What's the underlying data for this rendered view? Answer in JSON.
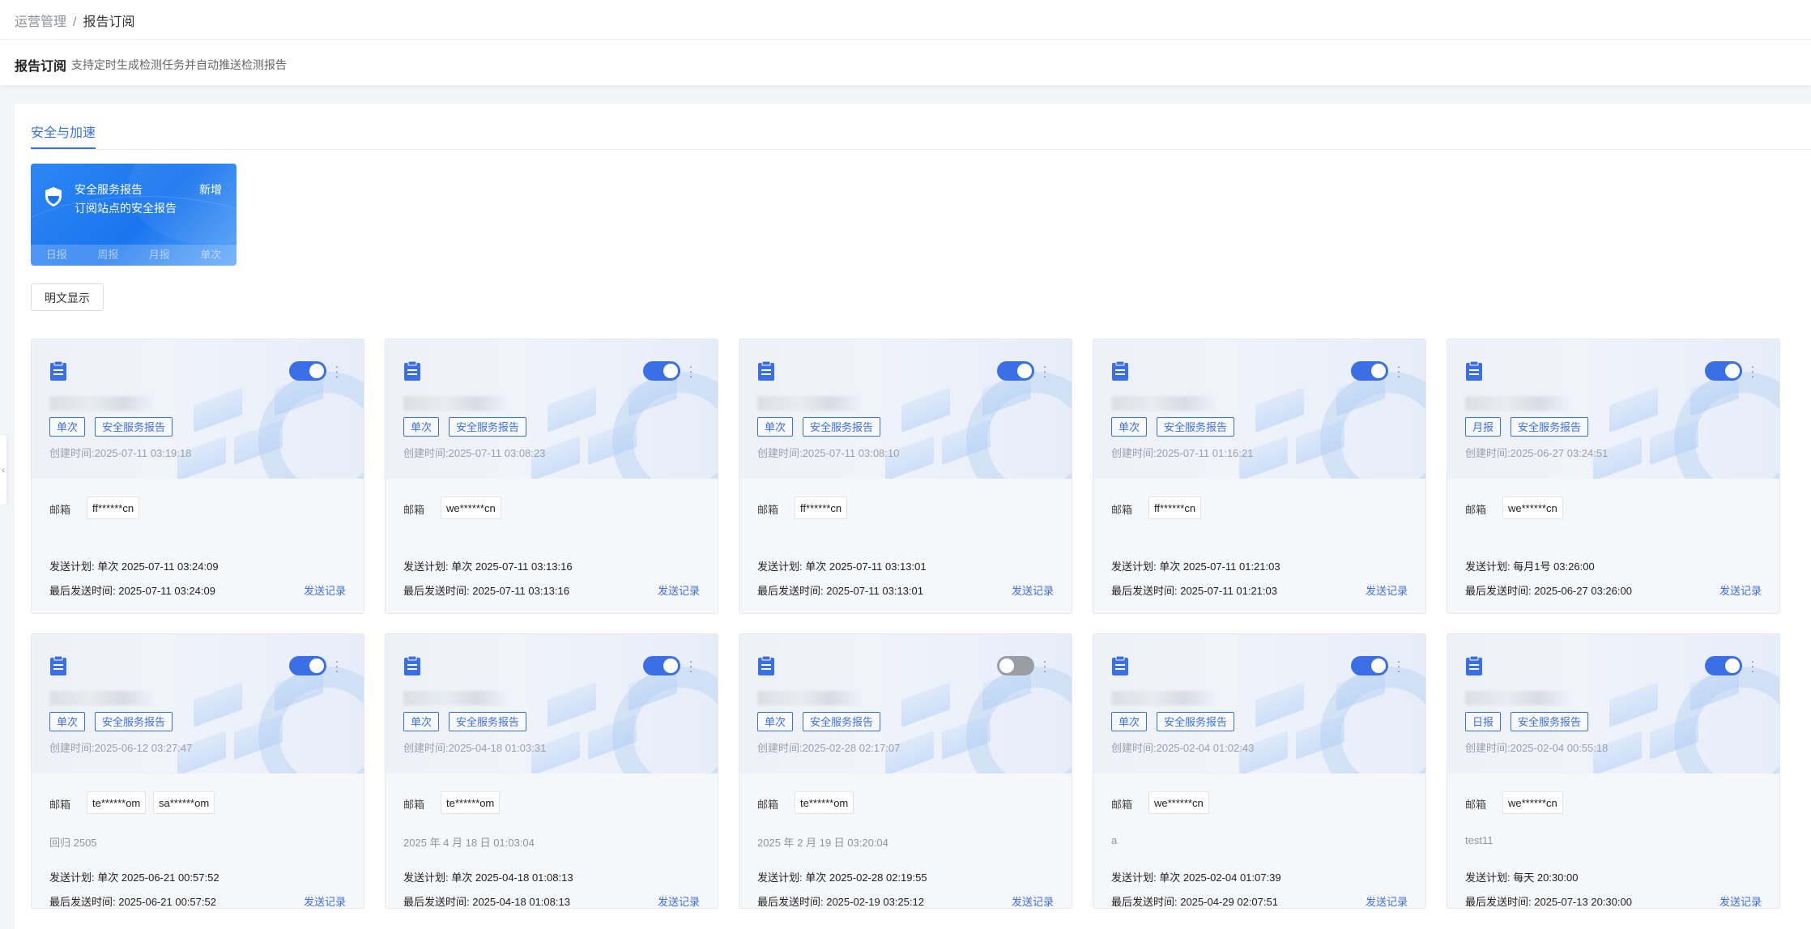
{
  "breadcrumb": {
    "parent": "运营管理",
    "separator": "/",
    "current": "报告订阅"
  },
  "header": {
    "title": "报告订阅",
    "description": "支持定时生成检测任务并自动推送检测报告"
  },
  "tabs": [
    {
      "label": "安全与加速",
      "active": true
    }
  ],
  "promo": {
    "title": "安全服务报告",
    "subtitle": "订阅站点的安全报告",
    "add_label": "新增",
    "frequencies": [
      "日报",
      "周报",
      "月报",
      "单次"
    ]
  },
  "plain_toggle_label": "明文显示",
  "labels": {
    "email": "邮箱",
    "history": "发送记录"
  },
  "colors": {
    "accent": "#3b6fe8",
    "toggle_on": "#3b6fe8",
    "toggle_off": "#9a9da3"
  },
  "cards": [
    {
      "enabled": true,
      "freq": "单次",
      "type": "安全服务报告",
      "created": "创建时间:2025-07-11 03:19:18",
      "emails": [
        "ff******cn"
      ],
      "note": "",
      "plan": "发送计划: 单次 2025-07-11 03:24:09",
      "last": "最后发送时间: 2025-07-11 03:24:09"
    },
    {
      "enabled": true,
      "freq": "单次",
      "type": "安全服务报告",
      "created": "创建时间:2025-07-11 03:08:23",
      "emails": [
        "we******cn"
      ],
      "note": "",
      "plan": "发送计划: 单次 2025-07-11 03:13:16",
      "last": "最后发送时间: 2025-07-11 03:13:16"
    },
    {
      "enabled": true,
      "freq": "单次",
      "type": "安全服务报告",
      "created": "创建时间:2025-07-11 03:08:10",
      "emails": [
        "ff******cn"
      ],
      "note": "",
      "plan": "发送计划: 单次 2025-07-11 03:13:01",
      "last": "最后发送时间: 2025-07-11 03:13:01"
    },
    {
      "enabled": true,
      "freq": "单次",
      "type": "安全服务报告",
      "created": "创建时间:2025-07-11 01:16:21",
      "emails": [
        "ff******cn"
      ],
      "note": "",
      "plan": "发送计划: 单次 2025-07-11 01:21:03",
      "last": "最后发送时间: 2025-07-11 01:21:03"
    },
    {
      "enabled": true,
      "freq": "月报",
      "type": "安全服务报告",
      "created": "创建时间:2025-06-27 03:24:51",
      "emails": [
        "we******cn"
      ],
      "note": "",
      "plan": "发送计划: 每月1号 03:26:00",
      "last": "最后发送时间: 2025-06-27 03:26:00"
    },
    {
      "enabled": true,
      "freq": "单次",
      "type": "安全服务报告",
      "created": "创建时间:2025-06-12 03:27:47",
      "emails": [
        "te******om",
        "sa******om"
      ],
      "note": "回归 2505",
      "plan": "发送计划: 单次 2025-06-21 00:57:52",
      "last": "最后发送时间: 2025-06-21 00:57:52"
    },
    {
      "enabled": true,
      "freq": "单次",
      "type": "安全服务报告",
      "created": "创建时间:2025-04-18 01:03:31",
      "emails": [
        "te******om"
      ],
      "note": "2025 年 4 月 18 日 01:03:04",
      "plan": "发送计划: 单次 2025-04-18 01:08:13",
      "last": "最后发送时间: 2025-04-18 01:08:13"
    },
    {
      "enabled": false,
      "freq": "单次",
      "type": "安全服务报告",
      "created": "创建时间:2025-02-28 02:17:07",
      "emails": [
        "te******om"
      ],
      "note": "2025 年 2 月 19 日 03:20:04",
      "plan": "发送计划: 单次 2025-02-28 02:19:55",
      "last": "最后发送时间: 2025-02-19 03:25:12"
    },
    {
      "enabled": true,
      "freq": "单次",
      "type": "安全服务报告",
      "created": "创建时间:2025-02-04 01:02:43",
      "emails": [
        "we******cn"
      ],
      "note": "a",
      "plan": "发送计划: 单次 2025-02-04 01:07:39",
      "last": "最后发送时间: 2025-04-29 02:07:51"
    },
    {
      "enabled": true,
      "freq": "日报",
      "type": "安全服务报告",
      "created": "创建时间:2025-02-04 00:55:18",
      "emails": [
        "we******cn"
      ],
      "note": "test11",
      "plan": "发送计划: 每天 20:30:00",
      "last": "最后发送时间: 2025-07-13 20:30:00"
    }
  ]
}
